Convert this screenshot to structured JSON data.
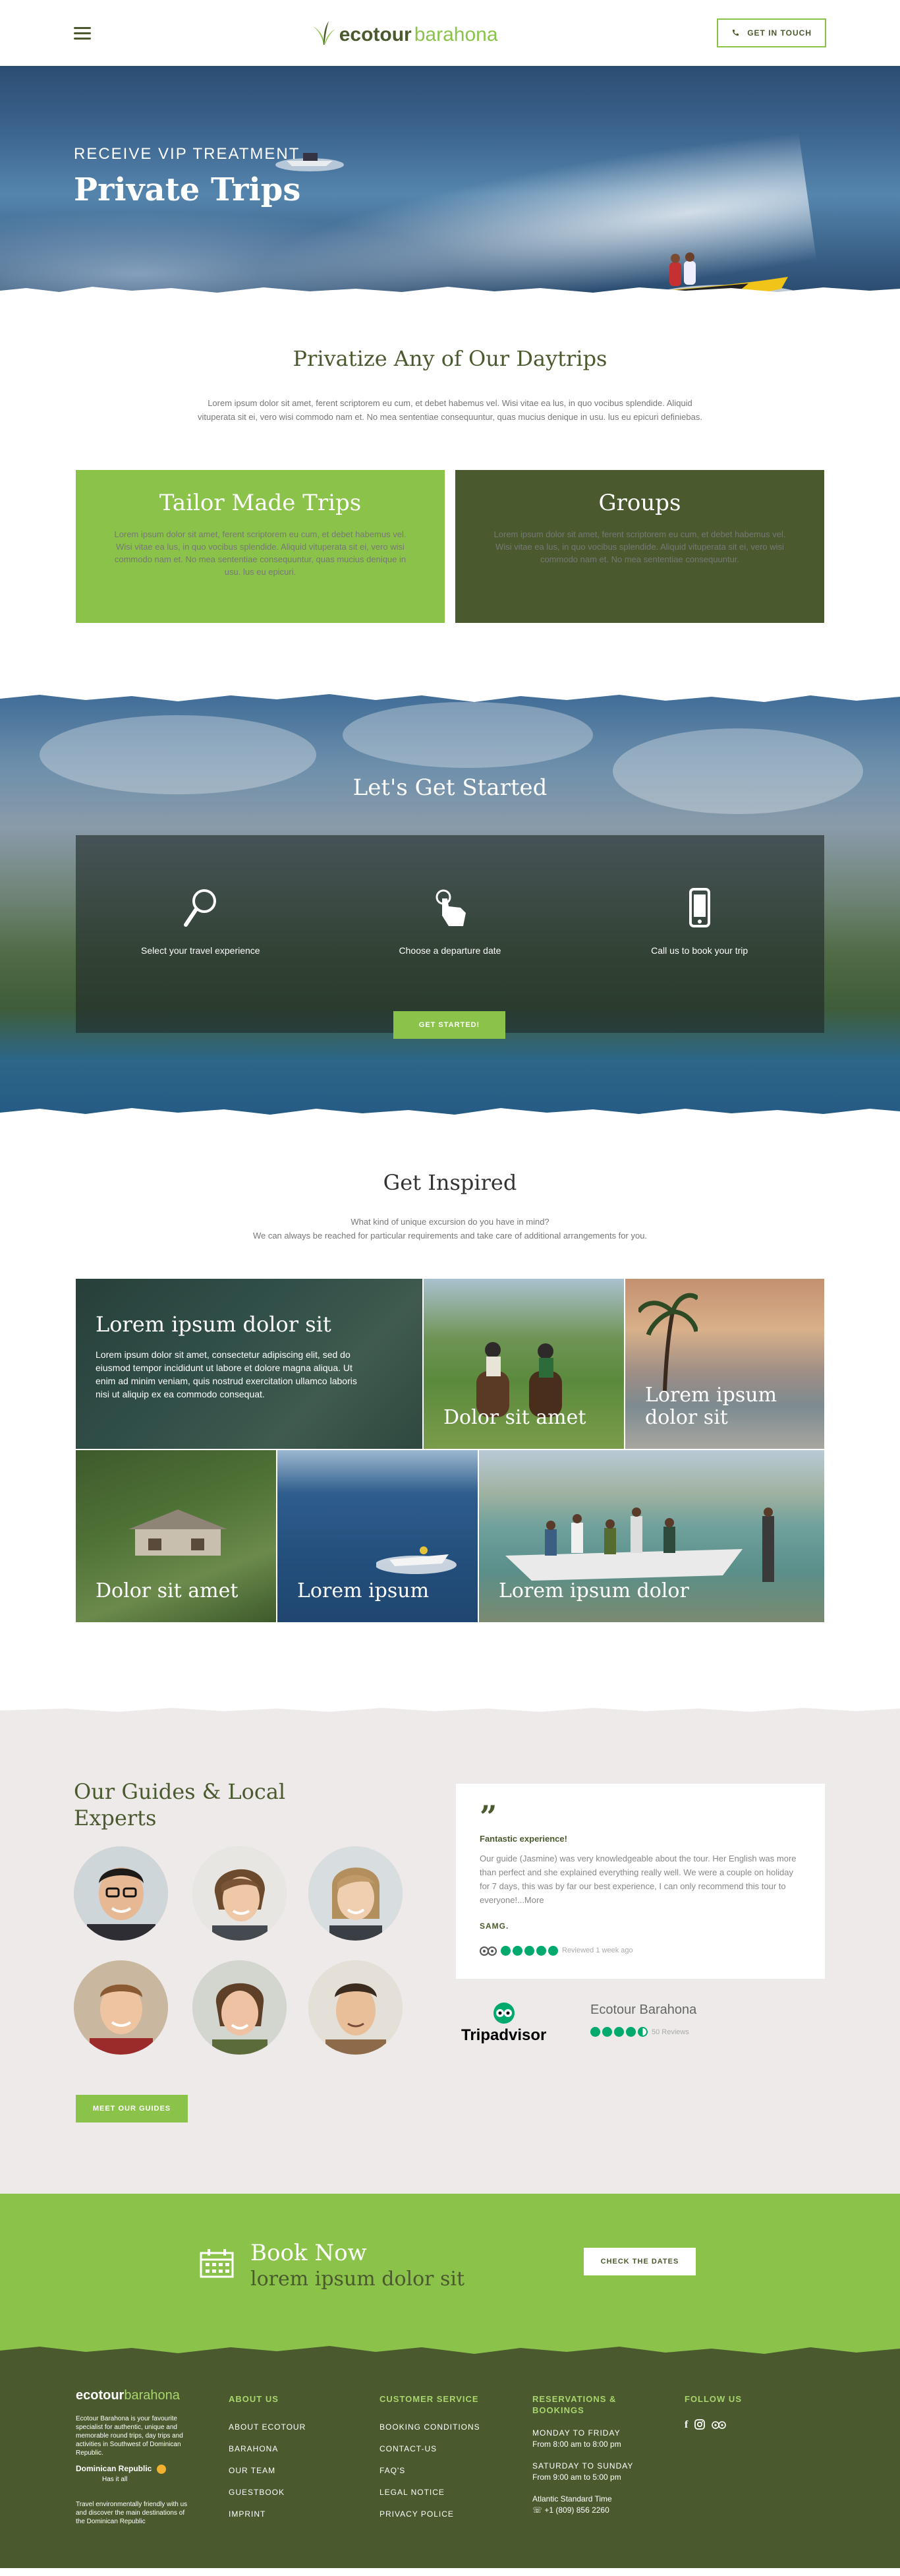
{
  "header": {
    "logo_eco": "ecotour",
    "logo_bar": "barahona",
    "touch_label": "GET IN TOUCH"
  },
  "hero": {
    "subtitle": "RECEIVE VIP TREATMENT",
    "title": "Private Trips"
  },
  "intro": {
    "title": "Privatize Any of Our Daytrips",
    "text": "Lorem ipsum dolor sit amet, ferent scriptorem eu cum, et debet habemus vel. Wisi vitae ea lus, in quo vocibus splendide. Aliquid vituperata sit ei, vero wisi commodo nam et. No mea sententiae consequuntur, quas mucius denique in usu. lus eu epicuri definiebas."
  },
  "cards": [
    {
      "title": "Tailor Made Trips",
      "text": "Lorem ipsum dolor sit amet, ferent scriptorem eu cum, et debet habemus vel. Wisi vitae ea lus, in quo vocibus splendide. Aliquid vituperata sit ei, vero wisi commodo nam et. No mea sententiae consequuntur, quas mucius denique in usu. lus eu epicuri."
    },
    {
      "title": "Groups",
      "text": "Lorem ipsum dolor sit amet, ferent scriptorem eu cum, et debet habemus vel. Wisi vitae ea lus, in quo vocibus splendide. Aliquid vituperata sit ei, vero wisi commodo nam et. No mea sententiae consequuntur."
    }
  ],
  "started": {
    "title": "Let's Get Started",
    "steps": [
      {
        "label": "Select your travel experience",
        "icon": "magnifier-icon"
      },
      {
        "label": "Choose a departure date",
        "icon": "hand-pointer-icon"
      },
      {
        "label": "Call us to book your trip",
        "icon": "phone-icon"
      }
    ],
    "button": "GET STARTED!"
  },
  "inspired": {
    "title": "Get Inspired",
    "line1": "What kind of unique excursion do you have in mind?",
    "line2": "We can always be reached for particular requirements and take care of additional arrangements for you.",
    "featured_title": "Lorem ipsum dolor sit",
    "featured_text": "Lorem ipsum dolor sit amet, consectetur adipiscing elit, sed do eiusmod tempor incididunt ut labore et dolore magna aliqua. Ut enim ad minim veniam, quis nostrud exercitation ullamco laboris nisi ut aliquip ex ea commodo consequat.",
    "tiles": [
      "Dolor sit amet",
      "Lorem ipsum dolor sit",
      "Dolor sit amet",
      "Lorem ipsum",
      "Lorem ipsum dolor"
    ]
  },
  "guides": {
    "title_line1": "Our Guides & Local",
    "title_line2": "Experts",
    "button": "MEET OUR GUIDES",
    "review": {
      "quote": "”",
      "title": "Fantastic experience!",
      "text": "Our guide (Jasmine) was very knowledgeable about the tour. Her English was more than perfect and she explained everything really well. We were a couple on holiday for 7 days, this was by far our best experience, I can only recommend this tour to everyone!...More",
      "author": "SAMG.",
      "when": "Reviewed 1 week ago",
      "rating": 5
    },
    "tripadvisor": {
      "brand": "Tripadvisor",
      "business": "Ecotour Barahona",
      "reviews": "50 Reviews",
      "rating": 4.5
    }
  },
  "book": {
    "title": "Book Now",
    "tagline": "lorem ipsum dolor sit",
    "button": "CHECK THE DATES"
  },
  "footer": {
    "logo_eco": "ecotour",
    "logo_bar": "barahona",
    "about": "Ecotour Barahona is your favourite specialist for authentic, unique and memorable round trips, day trips and activities in Southwest of Dominican Republic.",
    "dr_brand_1": "Dominican Republic",
    "dr_brand_2": "Has it all",
    "eco_note": "Travel environmentally friendly with us and discover the main destinations of the Dominican Republic",
    "about_us": {
      "heading": "ABOUT US",
      "items": [
        "ABOUT ECOTOUR",
        "BARAHONA",
        "OUR TEAM",
        "GUESTBOOK",
        "IMPRINT"
      ]
    },
    "service": {
      "heading": "CUSTOMER SERVICE",
      "items": [
        "BOOKING CONDITIONS",
        "CONTACT-US",
        "FAQ'S",
        "LEGAL NOTICE",
        "PRIVACY POLICE"
      ]
    },
    "reservations": {
      "heading_1": "RESERVATIONS &",
      "heading_2": "BOOKINGS",
      "weekday_label": "MONDAY TO FRIDAY",
      "weekday_hours": "From 8:00 am to 8:00 pm",
      "weekend_label": "SATURDAY TO SUNDAY",
      "weekend_hours": "From 9:00 am to 5:00 pm",
      "tz": "Atlantic Standard Time",
      "phone": "+1 (809) 856 2260"
    },
    "follow": {
      "heading": "FOLLOW US",
      "icons": [
        "facebook-icon",
        "instagram-icon",
        "tripadvisor-icon"
      ]
    }
  },
  "colors": {
    "green": "#8bc34a",
    "dark_green": "#4a5a2e",
    "tripadvisor": "#00aa6c"
  }
}
